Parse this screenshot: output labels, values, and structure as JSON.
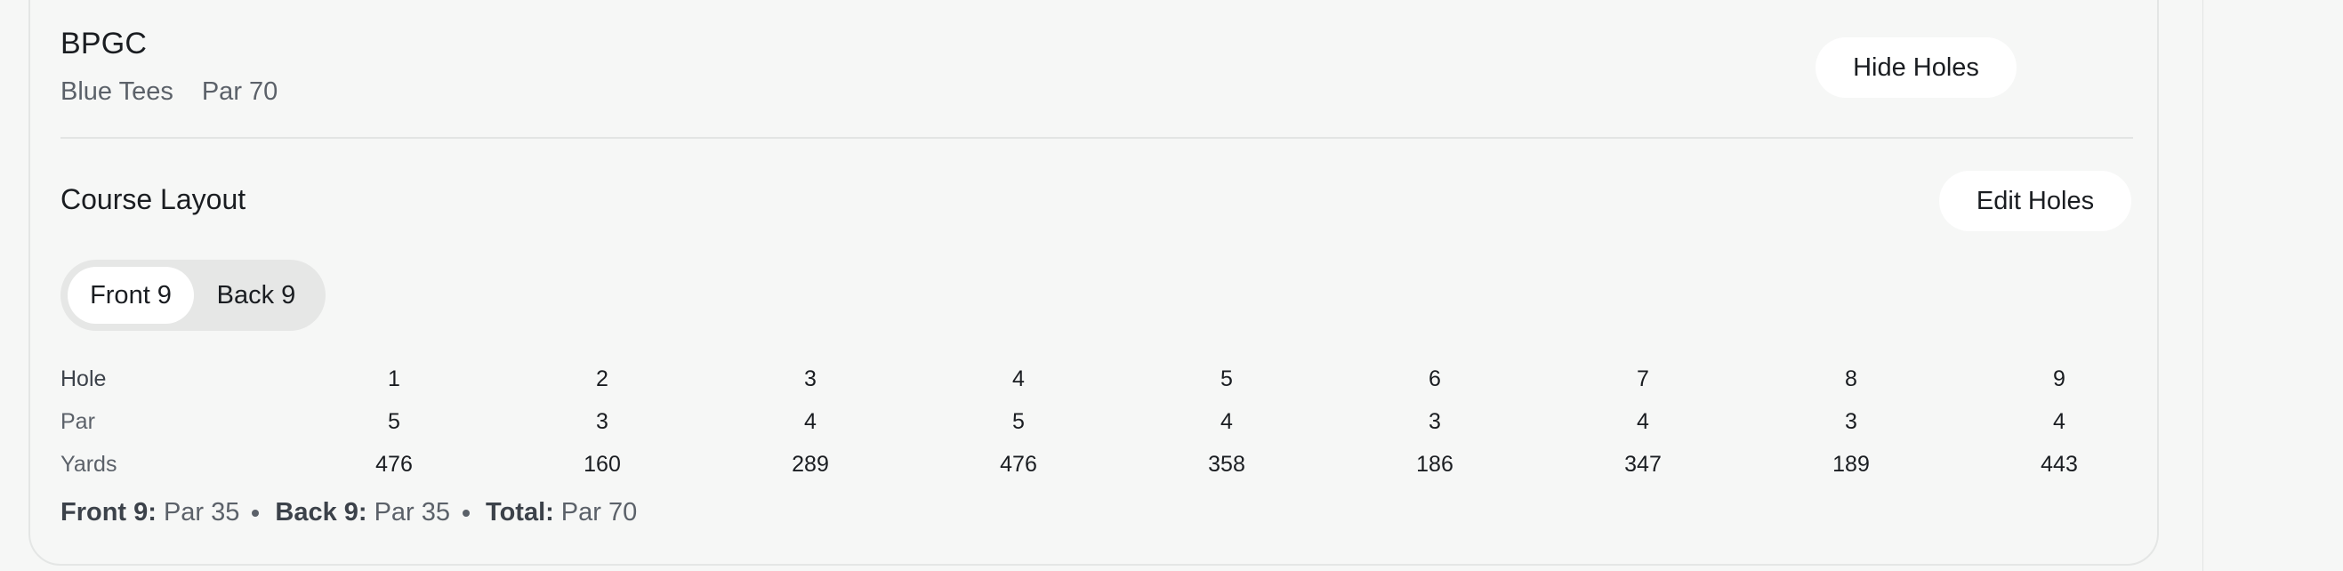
{
  "course": {
    "name": "BPGC",
    "tees": "Blue Tees",
    "par_label": "Par 70"
  },
  "buttons": {
    "hide_holes": "Hide Holes",
    "edit_holes": "Edit Holes"
  },
  "layout": {
    "title": "Course Layout",
    "tabs": [
      {
        "label": "Front 9",
        "active": true
      },
      {
        "label": "Back 9",
        "active": false
      }
    ],
    "row_labels": {
      "hole": "Hole",
      "par": "Par",
      "yards": "Yards"
    },
    "holes": [
      {
        "hole": "1",
        "par": "5",
        "yards": "476"
      },
      {
        "hole": "2",
        "par": "3",
        "yards": "160"
      },
      {
        "hole": "3",
        "par": "4",
        "yards": "289"
      },
      {
        "hole": "4",
        "par": "5",
        "yards": "476"
      },
      {
        "hole": "5",
        "par": "4",
        "yards": "358"
      },
      {
        "hole": "6",
        "par": "3",
        "yards": "186"
      },
      {
        "hole": "7",
        "par": "4",
        "yards": "347"
      },
      {
        "hole": "8",
        "par": "3",
        "yards": "189"
      },
      {
        "hole": "9",
        "par": "4",
        "yards": "443"
      }
    ]
  },
  "summary": {
    "front_label": "Front 9:",
    "front_value": "Par 35",
    "back_label": "Back 9:",
    "back_value": "Par 35",
    "total_label": "Total:",
    "total_value": "Par 70"
  }
}
